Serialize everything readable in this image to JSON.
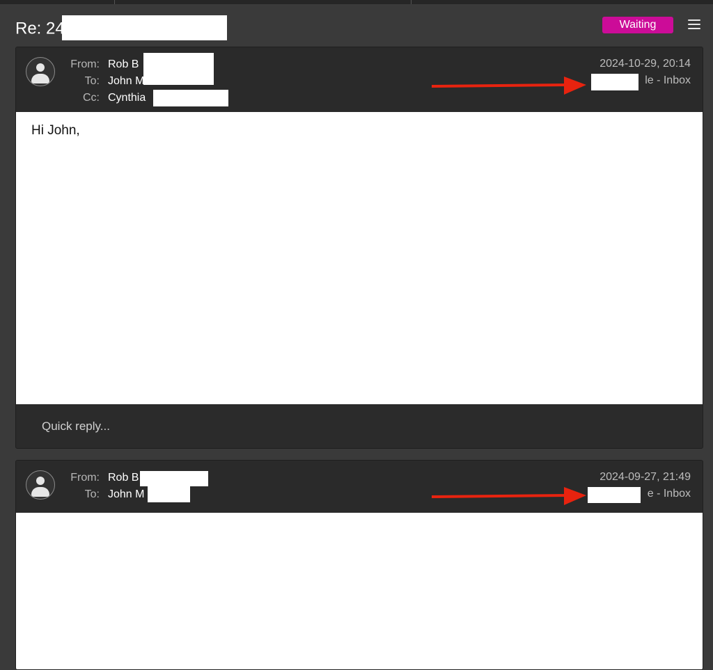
{
  "thread": {
    "subject": "Re: 24",
    "status_label": "Waiting",
    "status_color": "#cc0c98",
    "menu_icon": "hamburger-menu-icon"
  },
  "messages": [
    {
      "from_label": "From:",
      "from_value": "Rob B",
      "to_label": "To:",
      "to_value": "John M",
      "cc_label": "Cc:",
      "cc_value": "Cynthia",
      "date": "2024-10-29, 20:14",
      "folder": "le - Inbox",
      "body_text": "Hi John,",
      "quick_reply_placeholder": "Quick reply..."
    },
    {
      "from_label": "From:",
      "from_value": "Rob B",
      "to_label": "To:",
      "to_value": "John M",
      "date": "2024-09-27, 21:49",
      "folder": "e - Inbox"
    }
  ],
  "annotation": {
    "arrow_color": "#e8230f"
  }
}
